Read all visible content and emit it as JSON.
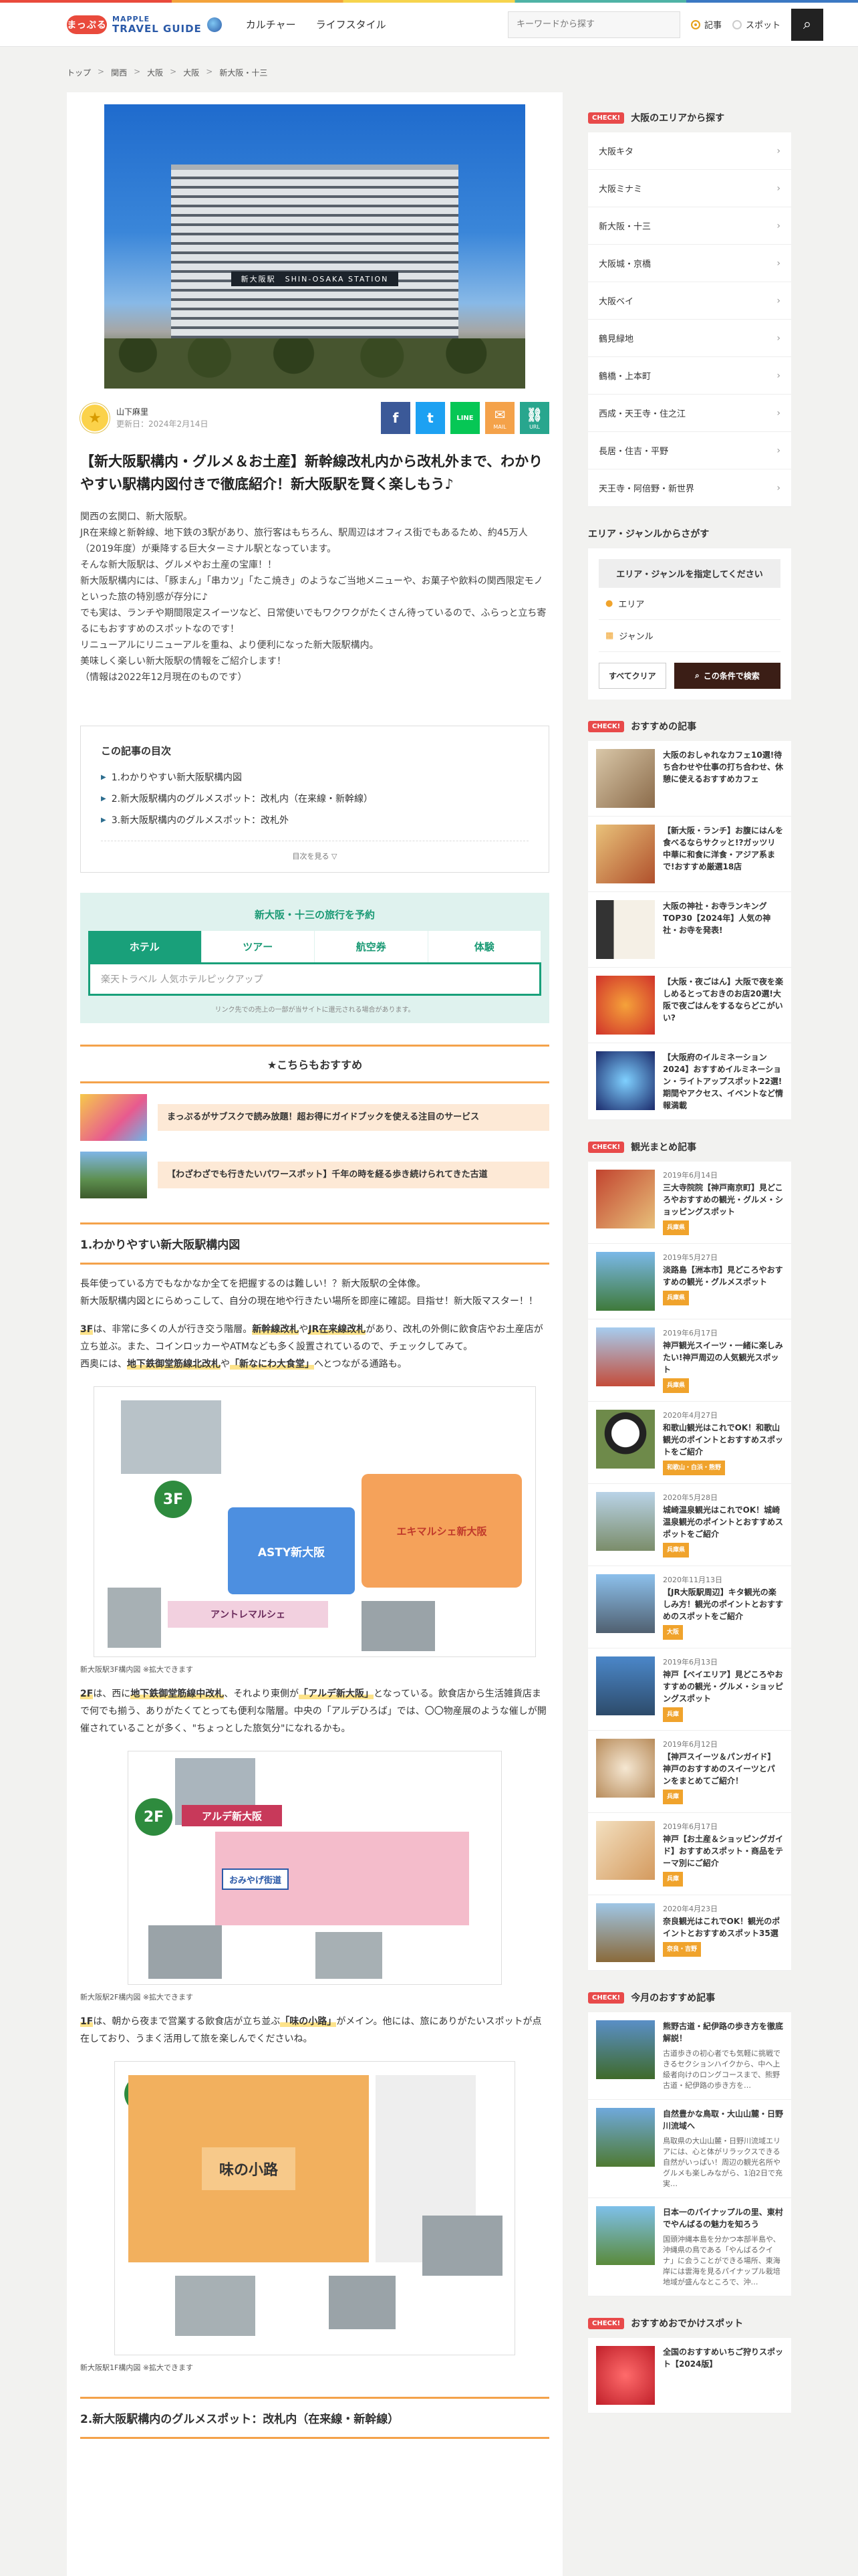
{
  "header": {
    "logo_badge": "まっぷる",
    "logo_line1": "MAPPLE",
    "logo_line2": "TRAVEL GUIDE",
    "nav": [
      "カルチャー",
      "ライフスタイル"
    ],
    "search_placeholder": "キーワードから探す",
    "radio_article": "記事",
    "radio_spot": "スポット"
  },
  "breadcrumb": [
    "トップ",
    "関西",
    "大阪",
    "大阪",
    "新大阪・十三"
  ],
  "article": {
    "hero_sign_jp": "新大阪駅",
    "hero_sign_en": "SHIN-OSAKA STATION",
    "author_name": "山下麻里",
    "updated": "更新日：2024年2月14日",
    "share": {
      "facebook": "f",
      "twitter": "t",
      "line": "LINE",
      "mail": "✉",
      "mail_label": "MAIL",
      "url": "⛓",
      "url_label": "URL"
    },
    "title": "【新大阪駅構内・グルメ＆お土産】新幹線改札内から改札外まで、わかりやすい駅構内図付きで徹底紹介！新大阪駅を賢く楽しもう♪",
    "lead": [
      "関西の玄関口、新大阪駅。",
      "JR在来線と新幹線、地下鉄の3駅があり、旅行客はもちろん、駅周辺はオフィス街でもあるため、約45万人（2019年度）が乗降する巨大ターミナル駅となっています。",
      "そんな新大阪駅は、グルメやお土産の宝庫！！",
      "新大阪駅構内には、「豚まん」「串カツ」「たこ焼き」のようなご当地メニューや、お菓子や飲料の関西限定モノといった旅の特別感が存分に♪",
      "でも実は、ランチや期間限定スイーツなど、日常使いでもワクワクがたくさん待っているので、ふらっと立ち寄るにもおすすめのスポットなのです！",
      "リニューアルにリニューアルを重ね、より便利になった新大阪駅構内。",
      "美味しく楽しい新大阪駅の情報をご紹介します！",
      "（情報は2022年12月現在のものです）"
    ],
    "toc_title": "この記事の目次",
    "toc": [
      "1.わかりやすい新大阪駅構内図",
      "2.新大阪駅構内のグルメスポット：改札内（在来線・新幹線）",
      "3.新大阪駅構内のグルメスポット：改札外"
    ],
    "toc_more": "目次を見る ▽",
    "booking": {
      "title": "新大阪・十三の旅行を予約",
      "tabs": [
        "ホテル",
        "ツアー",
        "航空券",
        "体験"
      ],
      "input": "楽天トラベル 人気ホテルピックアップ",
      "note": "リンク先での売上の一部が当サイトに還元される場合があります。"
    },
    "reco_title": "★こちらもおすすめ",
    "reco_items": [
      "まっぷるがサブスクで読み放題！超お得にガイドブックを使える注目のサービス",
      "【わざわざでも行きたいパワースポット】千年の時を経る歩き続けられてきた古道"
    ],
    "section1_title": "1.わかりやすい新大阪駅構内図",
    "section1_p1": "長年使っている方でもなかなか全てを把握するのは難しい！？新大阪駅の全体像。",
    "section1_p2": "新大阪駅構内図とにらめっこして、自分の現在地や行きたい場所を即座に確認。目指せ！新大阪マスター！！",
    "f3_text_a": "3F",
    "f3_text_b": "は、非常に多くの人が行き交う階層。",
    "f3_hl1": "新幹線改札",
    "f3_text_c": "や",
    "f3_hl2": "JR在来線改札",
    "f3_text_d": "があり、改札の外側に飲食店やお土産店が立ち並ぶ。また、コインロッカーやATMなども多く設置されているので、チェックしてみて。",
    "f3_text_e": "西奥には、",
    "f3_hl3": "地下鉄御堂筋線北改札",
    "f3_text_f": "や",
    "f3_hl4": "「新なにわ大食堂」",
    "f3_text_g": "へとつながる通路も。",
    "map3_caption": "新大阪駅3F構内図 ※拡大できます",
    "f2_text_a": "2F",
    "f2_text_b": "は、西に",
    "f2_hl1": "地下鉄御堂筋線中改札",
    "f2_text_c": "、それより東側が",
    "f2_hl2": "「アルデ新大阪」",
    "f2_text_d": "となっている。飲食店から生活雑貨店まで何でも揃う、ありがたくてとっても便利な階層。中央の「アルデひろば」では、〇〇物産展のような催しが開催されていることが多く、\"ちょっとした旅気分\"になれるかも。",
    "map2_caption": "新大阪駅2F構内図 ※拡大できます",
    "f1_text_a": "1F",
    "f1_text_b": "は、朝から夜まで営業する飲食店が立ち並ぶ",
    "f1_hl1": "「味の小路」",
    "f1_text_c": "がメイン。他には、旅にありがたいスポットが点在しており、うまく活用して旅を楽しんでくださいね。",
    "map1_caption": "新大阪駅1F構内図 ※拡大できます",
    "map1_label": "味の小路",
    "map2_label_ard": "アルデ新大阪",
    "map2_label_omiyage": "おみやげ街道",
    "map3_label_asty": "ASTY新大阪",
    "map3_label_ekimarche": "エキマルシェ新大阪",
    "map3_label_antre": "アントレマルシェ",
    "section2_title": "2.新大阪駅構内のグルメスポット：改札内（在来線・新幹線）"
  },
  "sidebar": {
    "check": "CHECK!",
    "area_title": "大阪のエリアから探す",
    "areas": [
      "大阪キタ",
      "大阪ミナミ",
      "新大阪・十三",
      "大阪城・京橋",
      "大阪ベイ",
      "鶴見緑地",
      "鶴橋・上本町",
      "西成・天王寺・住之江",
      "長居・住吉・平野",
      "天王寺・阿倍野・新世界"
    ],
    "genre_title": "エリア・ジャンルからさがす",
    "genre_select": "エリア・ジャンルを指定してください",
    "genre_area": "エリア",
    "genre_genre": "ジャンル",
    "clear": "すべてクリア",
    "search": "この条件で検索",
    "recommended_title": "おすすめの記事",
    "recommended": [
      "大阪のおしゃれなカフェ10選!待ち合わせや仕事の打ち合わせ、休憩に使えるおすすめカフェ",
      "【新大阪・ランチ】お腹にはんを食べるならサクッと!?ガッツリ中華に和食に洋食・アジア系まで!おすすめ厳選18店",
      "大阪の神社・お寺ランキングTOP30【2024年】人気の神社・お寺を発表!",
      "【大阪・夜ごはん】大阪で夜を楽しめるとっておきのお店20選!大阪で夜ごはんをするならどこがいい?",
      "【大阪府のイルミネーション2024】おすすめイルミネーション・ライトアップスポット22選!期間やアクセス、イベントなど情報満載"
    ],
    "matome_title": "観光まとめ記事",
    "matome": [
      {
        "date": "2019年6月14日",
        "title": "三大寺院院【神戸南京町】見どころやおすすめの観光・グルメ・ショッピングスポット",
        "tag": "兵庫県"
      },
      {
        "date": "2019年5月27日",
        "title": "淡路島【洲本市】見どころやおすすめの観光・グルメスポット",
        "tag": "兵庫県"
      },
      {
        "date": "2019年6月17日",
        "title": "神戸観光スイーツ・一緒に楽しみたい!神戸周辺の人気観光スポット",
        "tag": "兵庫県"
      },
      {
        "date": "2020年4月27日",
        "title": "和歌山観光はこれでOK！和歌山観光のポイントとおすすめスポットをご紹介",
        "tag": "和歌山・白浜・熊野"
      },
      {
        "date": "2020年5月28日",
        "title": "城崎温泉観光はこれでOK！城崎温泉観光のポイントとおすすめスポットをご紹介",
        "tag": "兵庫県"
      },
      {
        "date": "2020年11月13日",
        "title": "【JR大阪駅周辺】キタ観光の楽しみ方！観光のポイントとおすすめのスポットをご紹介",
        "tag": "大阪"
      },
      {
        "date": "2019年6月13日",
        "title": "神戸【ベイエリア】見どころやおすすめの観光・グルメ・ショッピングスポット",
        "tag": "兵庫"
      },
      {
        "date": "2019年6月12日",
        "title": "【神戸スイーツ＆パンガイド】神戸のおすすめのスイーツとパンをまとめてご紹介！",
        "tag": "兵庫"
      },
      {
        "date": "2019年6月17日",
        "title": "神戸【お土産＆ショッピングガイド】おすすめスポット・商品をテーマ別にご紹介",
        "tag": "兵庫"
      },
      {
        "date": "2020年4月23日",
        "title": "奈良観光はこれでOK！観光のポイントとおすすめスポット35選",
        "tag": "奈良・吉野"
      }
    ],
    "today_title": "今月のおすすめ記事",
    "today": [
      {
        "title": "熊野古道・紀伊路の歩き方を徹底解説！",
        "desc": "古道歩きの初心者でも気軽に挑戦できるセクションハイクから、中へ上級者向けのロングコースまで、熊野古道・紀伊路の歩き方を…"
      },
      {
        "title": "自然豊かな鳥取・大山山麓・日野川流域へ",
        "desc": "鳥取県の大山山麓・日野川流域エリアには、心と体がリラックスできる自然がいっぱい！周辺の観光名所やグルメも楽しみながら、1泊2日で充実…"
      },
      {
        "title": "日本一のパイナップルの里、東村でやんばるの魅力を知ろう",
        "desc": "国頭沖縄本島を分かつ本部半島や、沖縄県の鳥である「やんばるクイナ」に会うことができる場所、東海岸には雲海を見るパイナップル栽培地域が盛んなところで、沖…"
      }
    ],
    "odekake_title": "おすすめおでかけスポット",
    "odekake_first": "全国のおすすめいちご狩りスポット【2024版】"
  },
  "colors": {
    "accent": "#f4a24a",
    "check": "#e84a4a",
    "booking": "#19a07a",
    "facebook": "#3b5998",
    "twitter": "#1da1f2",
    "line": "#06c755",
    "mail": "#f4a24a",
    "url": "#28a68e"
  }
}
